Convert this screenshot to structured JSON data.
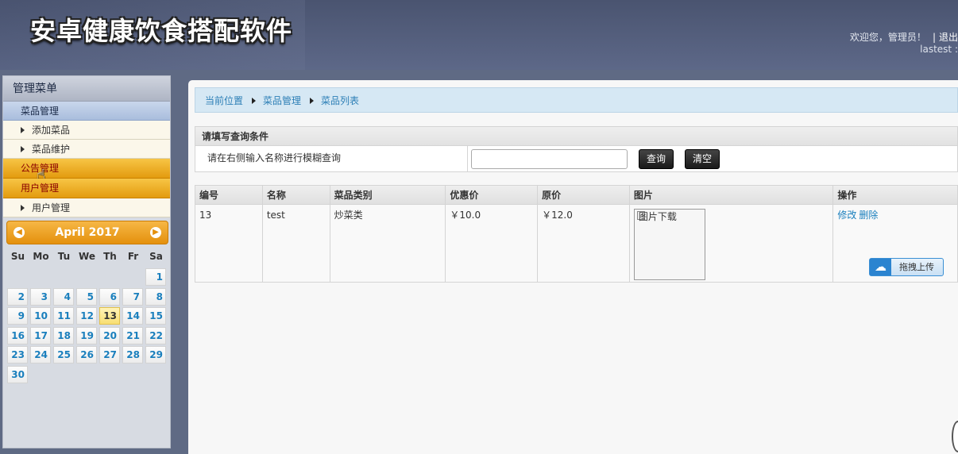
{
  "header": {
    "app_title": "安卓健康饮食搭配软件",
    "welcome": "欢迎您，管理员！",
    "separator": "|",
    "logout": "退出",
    "lastest": "lastest :"
  },
  "sidebar": {
    "title": "管理菜单",
    "groups": [
      {
        "label": "菜品管理",
        "items": [
          {
            "label": "添加菜品"
          },
          {
            "label": "菜品维护"
          }
        ]
      },
      {
        "label": "公告管理"
      },
      {
        "label": "用户管理",
        "items": [
          {
            "label": "用户管理"
          }
        ]
      }
    ]
  },
  "calendar": {
    "month_label": "April 2017",
    "prev": "◀",
    "next": "▶",
    "weekdays": [
      "Su",
      "Mo",
      "Tu",
      "We",
      "Th",
      "Fr",
      "Sa"
    ],
    "today": "13"
  },
  "breadcrumb": {
    "items": [
      "当前位置",
      "菜品管理",
      "菜品列表"
    ]
  },
  "query": {
    "title": "请填写查询条件",
    "hint": "请在右侧输入名称进行模糊查询",
    "input_value": "",
    "search_button": "查询",
    "clear_button": "清空"
  },
  "table": {
    "headers": [
      "编号",
      "名称",
      "菜品类别",
      "优惠价",
      "原价",
      "图片",
      "操作"
    ],
    "rows": [
      {
        "id": "13",
        "name": "test",
        "category": "炒菜类",
        "discount_price": "￥10.0",
        "original_price": "￥12.0",
        "image_alt": "图片下载",
        "edit": "修改",
        "delete": "删除"
      }
    ]
  },
  "upload": {
    "label": "拖拽上传"
  },
  "colors": {
    "accent_orange": "#e4900c",
    "link_blue": "#1a7fbd",
    "header_bg": "#5b6687"
  }
}
